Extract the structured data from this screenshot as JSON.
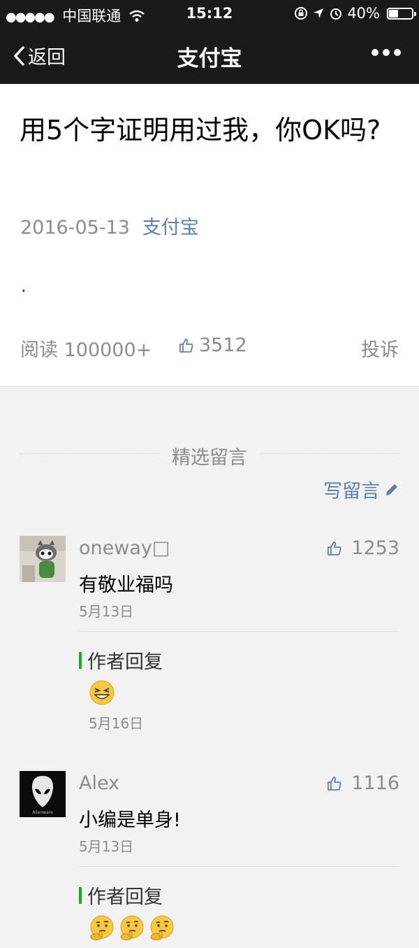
{
  "status_bar": {
    "carrier": "中国联通",
    "time": "15:12",
    "battery": "40%",
    "battery_level": 0.4
  },
  "nav": {
    "back_label": "返回",
    "title": "支付宝"
  },
  "article": {
    "title": "用5个字证明用过我，你OK吗?",
    "date": "2016-05-13",
    "author": "支付宝",
    "body": ".",
    "read_label": "阅读 100000+",
    "likes": "3512",
    "report_label": "投诉"
  },
  "comments_section": {
    "title": "精选留言",
    "write_label": "写留言"
  },
  "comments": [
    {
      "nickname": "oneway□",
      "likes": "1253",
      "text": "有敬业福吗",
      "date": "5月13日",
      "reply_label": "作者回复",
      "reply_emoji": [
        "grinning-squint-face"
      ],
      "reply_date": "5月16日"
    },
    {
      "nickname": "Alex",
      "likes": "1116",
      "text": "小编是单身!",
      "date": "5月13日",
      "reply_label": "作者回复",
      "reply_emoji": [
        "thinking-face",
        "thinking-face",
        "thinking-face"
      ],
      "avatar_logo_text": "Alienware"
    }
  ]
}
